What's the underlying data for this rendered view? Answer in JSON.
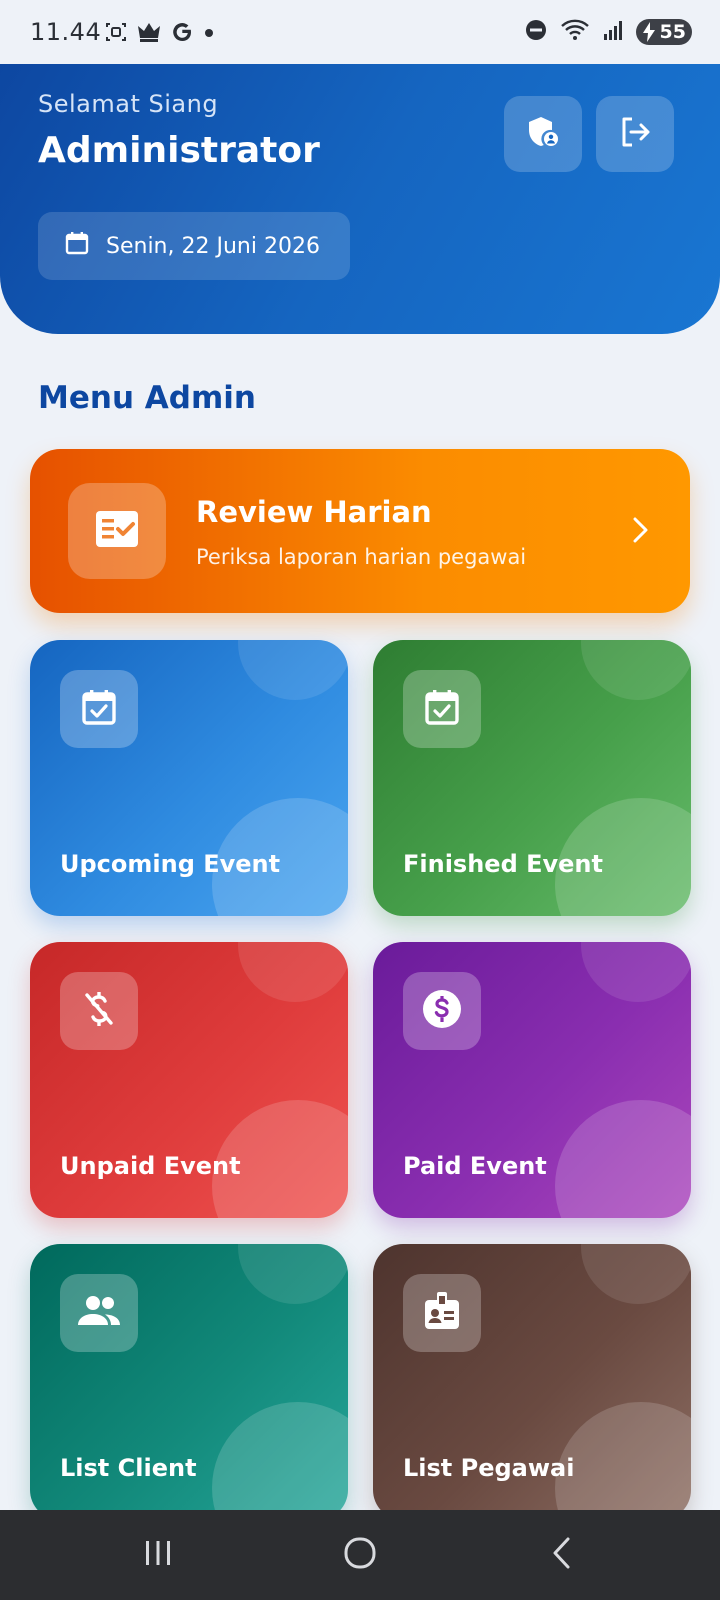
{
  "status_bar": {
    "time": "11.44",
    "notif_icons": [
      "screenshot-icon",
      "crown-icon",
      "google-icon",
      "dot-icon"
    ],
    "sys_icons": [
      "do-not-disturb-icon",
      "wifi-icon",
      "signal-icon",
      "battery-icon"
    ],
    "battery_level": "55"
  },
  "header": {
    "greeting": "Selamat Siang",
    "user_name": "Administrator",
    "date": "Senin, 22 Juni 2026",
    "actions": [
      "shield-user-icon",
      "logout-icon"
    ]
  },
  "menu": {
    "title": "Menu Admin",
    "review": {
      "title": "Review Harian",
      "subtitle": "Periksa laporan harian pegawai",
      "icon": "checklist-icon",
      "color": "#f57c00"
    },
    "tiles": [
      {
        "label": "Upcoming Event",
        "icon": "calendar-check-icon",
        "color": "#1e88e5"
      },
      {
        "label": "Finished Event",
        "icon": "calendar-check-icon",
        "color": "#43a047"
      },
      {
        "label": "Unpaid Event",
        "icon": "money-off-icon",
        "color": "#e53935"
      },
      {
        "label": "Paid Event",
        "icon": "dollar-circle-icon",
        "color": "#8e24aa"
      },
      {
        "label": "List Client",
        "icon": "people-icon",
        "color": "#00897b"
      },
      {
        "label": "List Pegawai",
        "icon": "badge-icon",
        "color": "#6d4c41"
      }
    ]
  },
  "nav_bar": {
    "buttons": [
      "recent-apps-icon",
      "home-icon",
      "back-icon"
    ]
  }
}
